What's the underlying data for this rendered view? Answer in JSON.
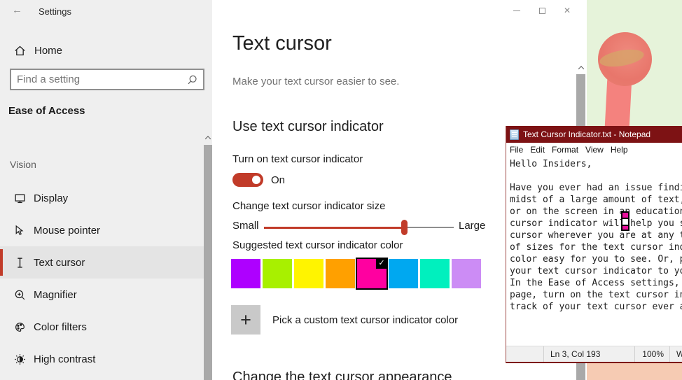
{
  "colors": {
    "accent": "#c13b29",
    "notepad_titlebar": "#7d1214",
    "cursor_pink": "#e8109c"
  },
  "settings": {
    "app_title": "Settings",
    "home_label": "Home",
    "search_placeholder": "Find a setting",
    "section_heading": "Ease of Access",
    "nav_group": "Vision",
    "nav_items": [
      {
        "label": "Display",
        "icon": "display-icon",
        "selected": false
      },
      {
        "label": "Mouse pointer",
        "icon": "mouse-pointer-icon",
        "selected": false
      },
      {
        "label": "Text cursor",
        "icon": "text-cursor-icon",
        "selected": true
      },
      {
        "label": "Magnifier",
        "icon": "magnifier-icon",
        "selected": false
      },
      {
        "label": "Color filters",
        "icon": "color-filters-icon",
        "selected": false
      },
      {
        "label": "High contrast",
        "icon": "high-contrast-icon",
        "selected": false
      }
    ]
  },
  "page": {
    "title": "Text cursor",
    "subtitle": "Make your text cursor easier to see.",
    "section1": "Use text cursor indicator",
    "toggle_label": "Turn on text cursor indicator",
    "toggle_state": "On",
    "size_label": "Change text cursor indicator size",
    "slider": {
      "min_label": "Small",
      "max_label": "Large",
      "value_pct": 74
    },
    "color_label": "Suggested text cursor indicator color",
    "swatches": [
      {
        "color": "#ae00ff",
        "selected": false
      },
      {
        "color": "#a8f000",
        "selected": false
      },
      {
        "color": "#fff400",
        "selected": false
      },
      {
        "color": "#ffa000",
        "selected": false
      },
      {
        "color": "#ff00a0",
        "selected": true
      },
      {
        "color": "#00a8f0",
        "selected": false
      },
      {
        "color": "#00f0be",
        "selected": false
      },
      {
        "color": "#cc8cf5",
        "selected": false
      }
    ],
    "custom_color_label": "Pick a custom text cursor indicator color",
    "section2": "Change the text cursor appearance"
  },
  "glyphs": {
    "back": "←",
    "close": "✕",
    "check": "✓",
    "plus": "+"
  },
  "notepad": {
    "title": "Text Cursor Indicator.txt - Notepad",
    "menu": [
      "File",
      "Edit",
      "Format",
      "View",
      "Help"
    ],
    "lines": [
      "Hello Insiders,",
      "",
      "Have you ever had an issue findi",
      "midst of a large amount of text,",
      "or on the screen in an education",
      "cursor indicator will help you s",
      "cursor wherever you are at any t",
      "of sizes for the text cursor ind",
      "color easy for you to see. Or, p",
      "your text cursor indicator to yo",
      "In the Ease of Access settings,",
      "page, turn on the text cursor in",
      "track of your text cursor ever a"
    ],
    "status": {
      "ln_col": "Ln 3, Col 193",
      "zoom": "100%",
      "encoding": "W"
    }
  }
}
